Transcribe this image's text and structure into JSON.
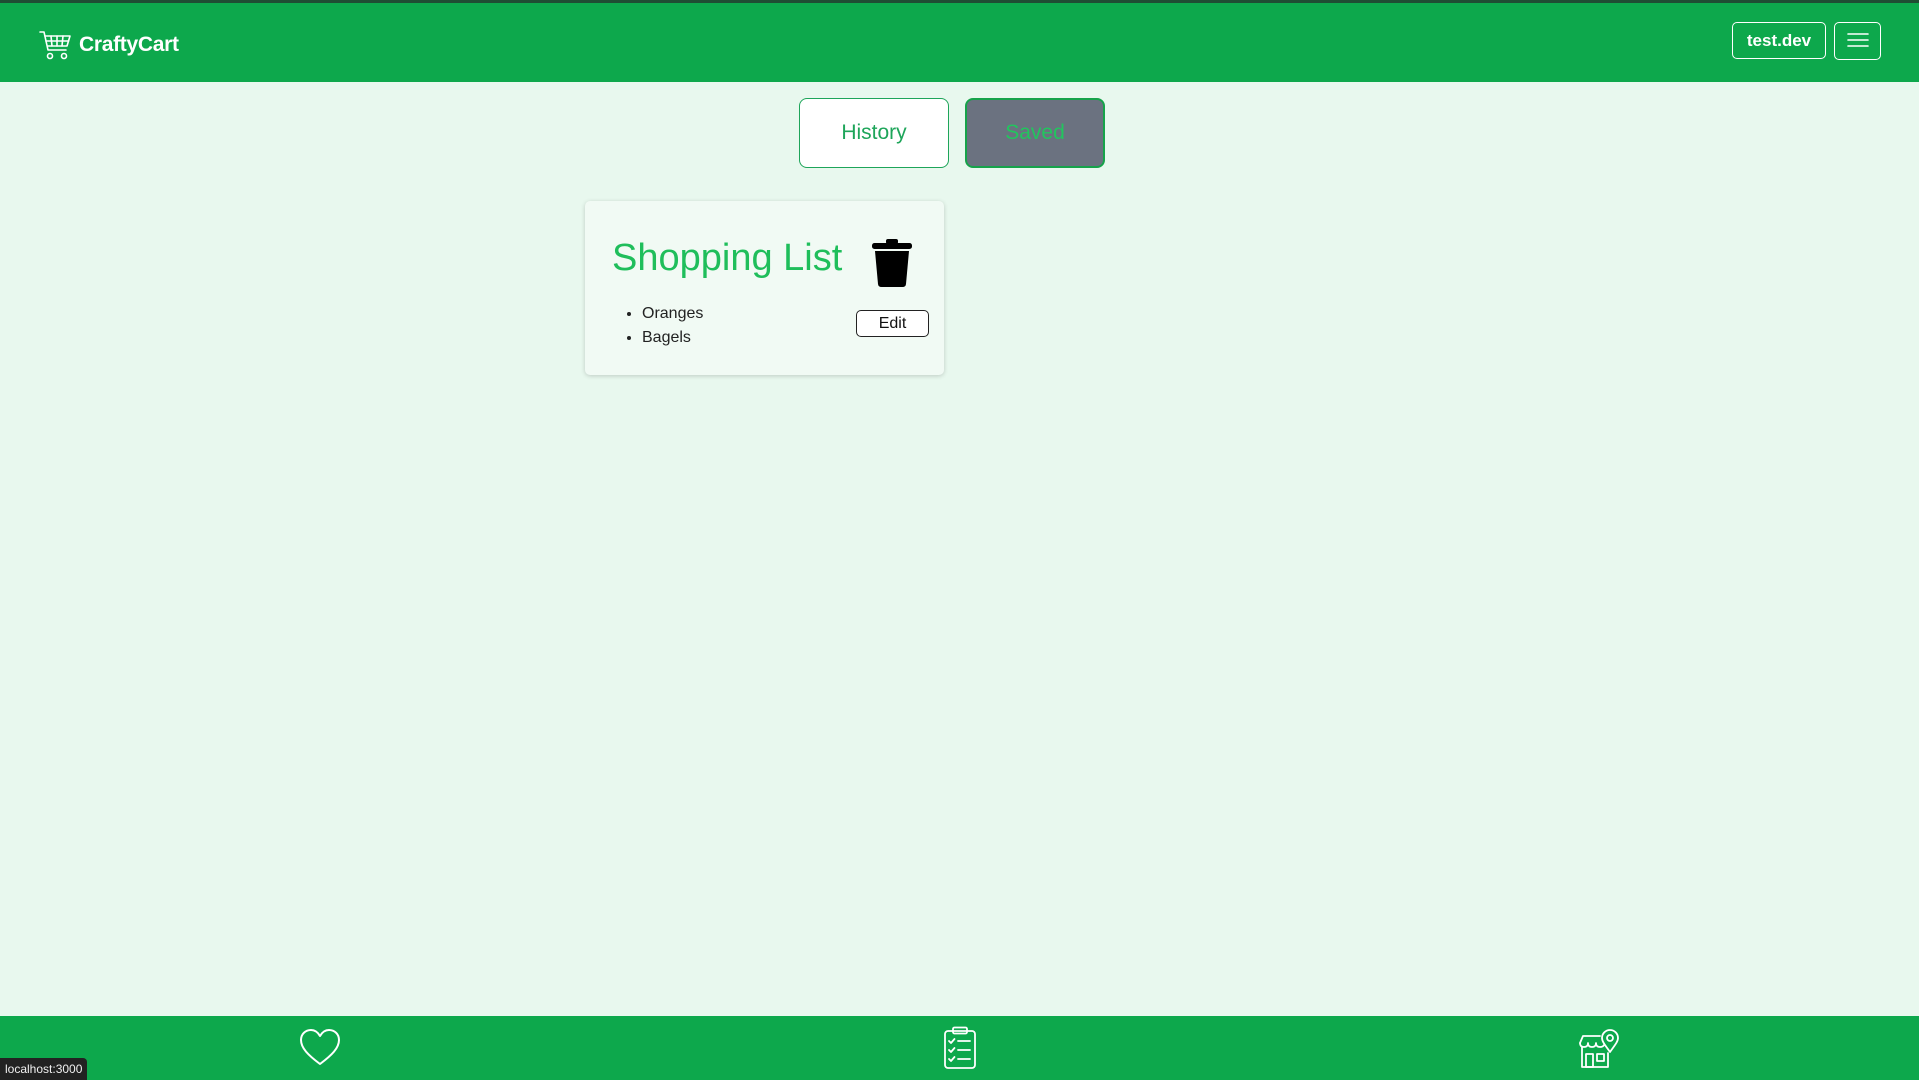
{
  "header": {
    "brand_name": "CraftyCart",
    "brand_icon": "cart-icon",
    "user_label": "test.dev",
    "menu_icon": "hamburger-menu-icon"
  },
  "tabs": {
    "history_label": "History",
    "saved_label": "Saved",
    "active": "Saved"
  },
  "lists": [
    {
      "title": "Shopping List",
      "items": [
        "Oranges",
        "Bagels"
      ],
      "edit_label": "Edit",
      "delete_icon": "trash-icon"
    }
  ],
  "bottom_nav": {
    "icons": [
      "heart-icon",
      "clipboard-checklist-icon",
      "store-location-icon"
    ]
  },
  "status_bar": {
    "url": "localhost:3000"
  },
  "colors": {
    "header_bg": "#0da84c",
    "page_bg": "#e8f8ee",
    "accent_green": "#1fbe5b",
    "saved_tab_bg": "#6b7280"
  }
}
